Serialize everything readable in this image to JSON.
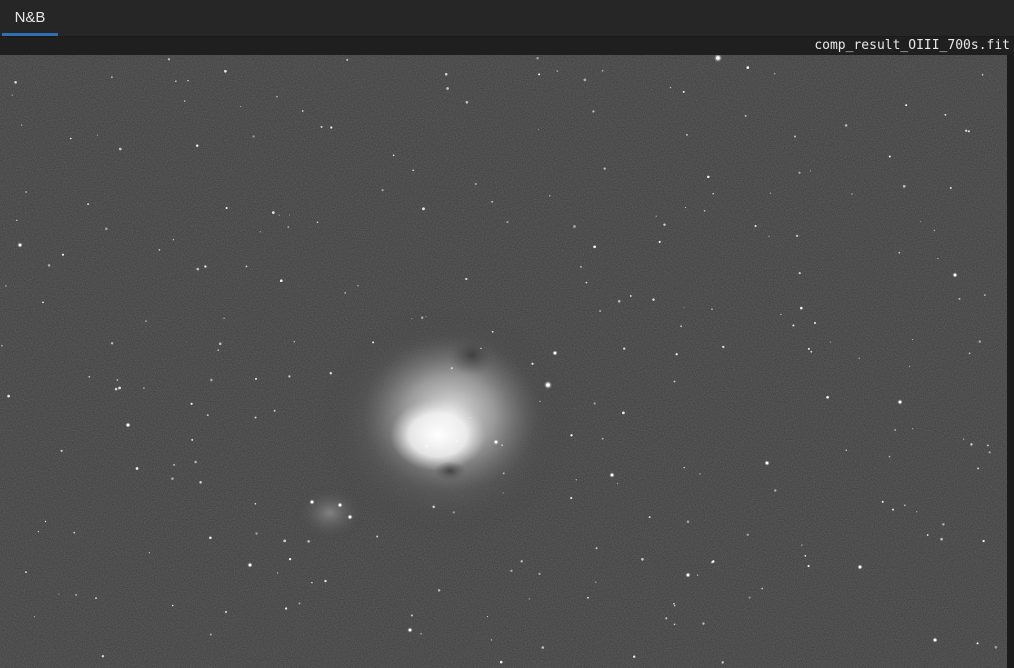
{
  "tabs": [
    {
      "label": "N&B",
      "active": true
    }
  ],
  "image": {
    "filename": "comp_result_OIII_700s.fit",
    "subject": "nebula-image"
  },
  "colors": {
    "accent": "#2f6fb2",
    "background": "#262626",
    "sky": "#3a3a3a"
  }
}
